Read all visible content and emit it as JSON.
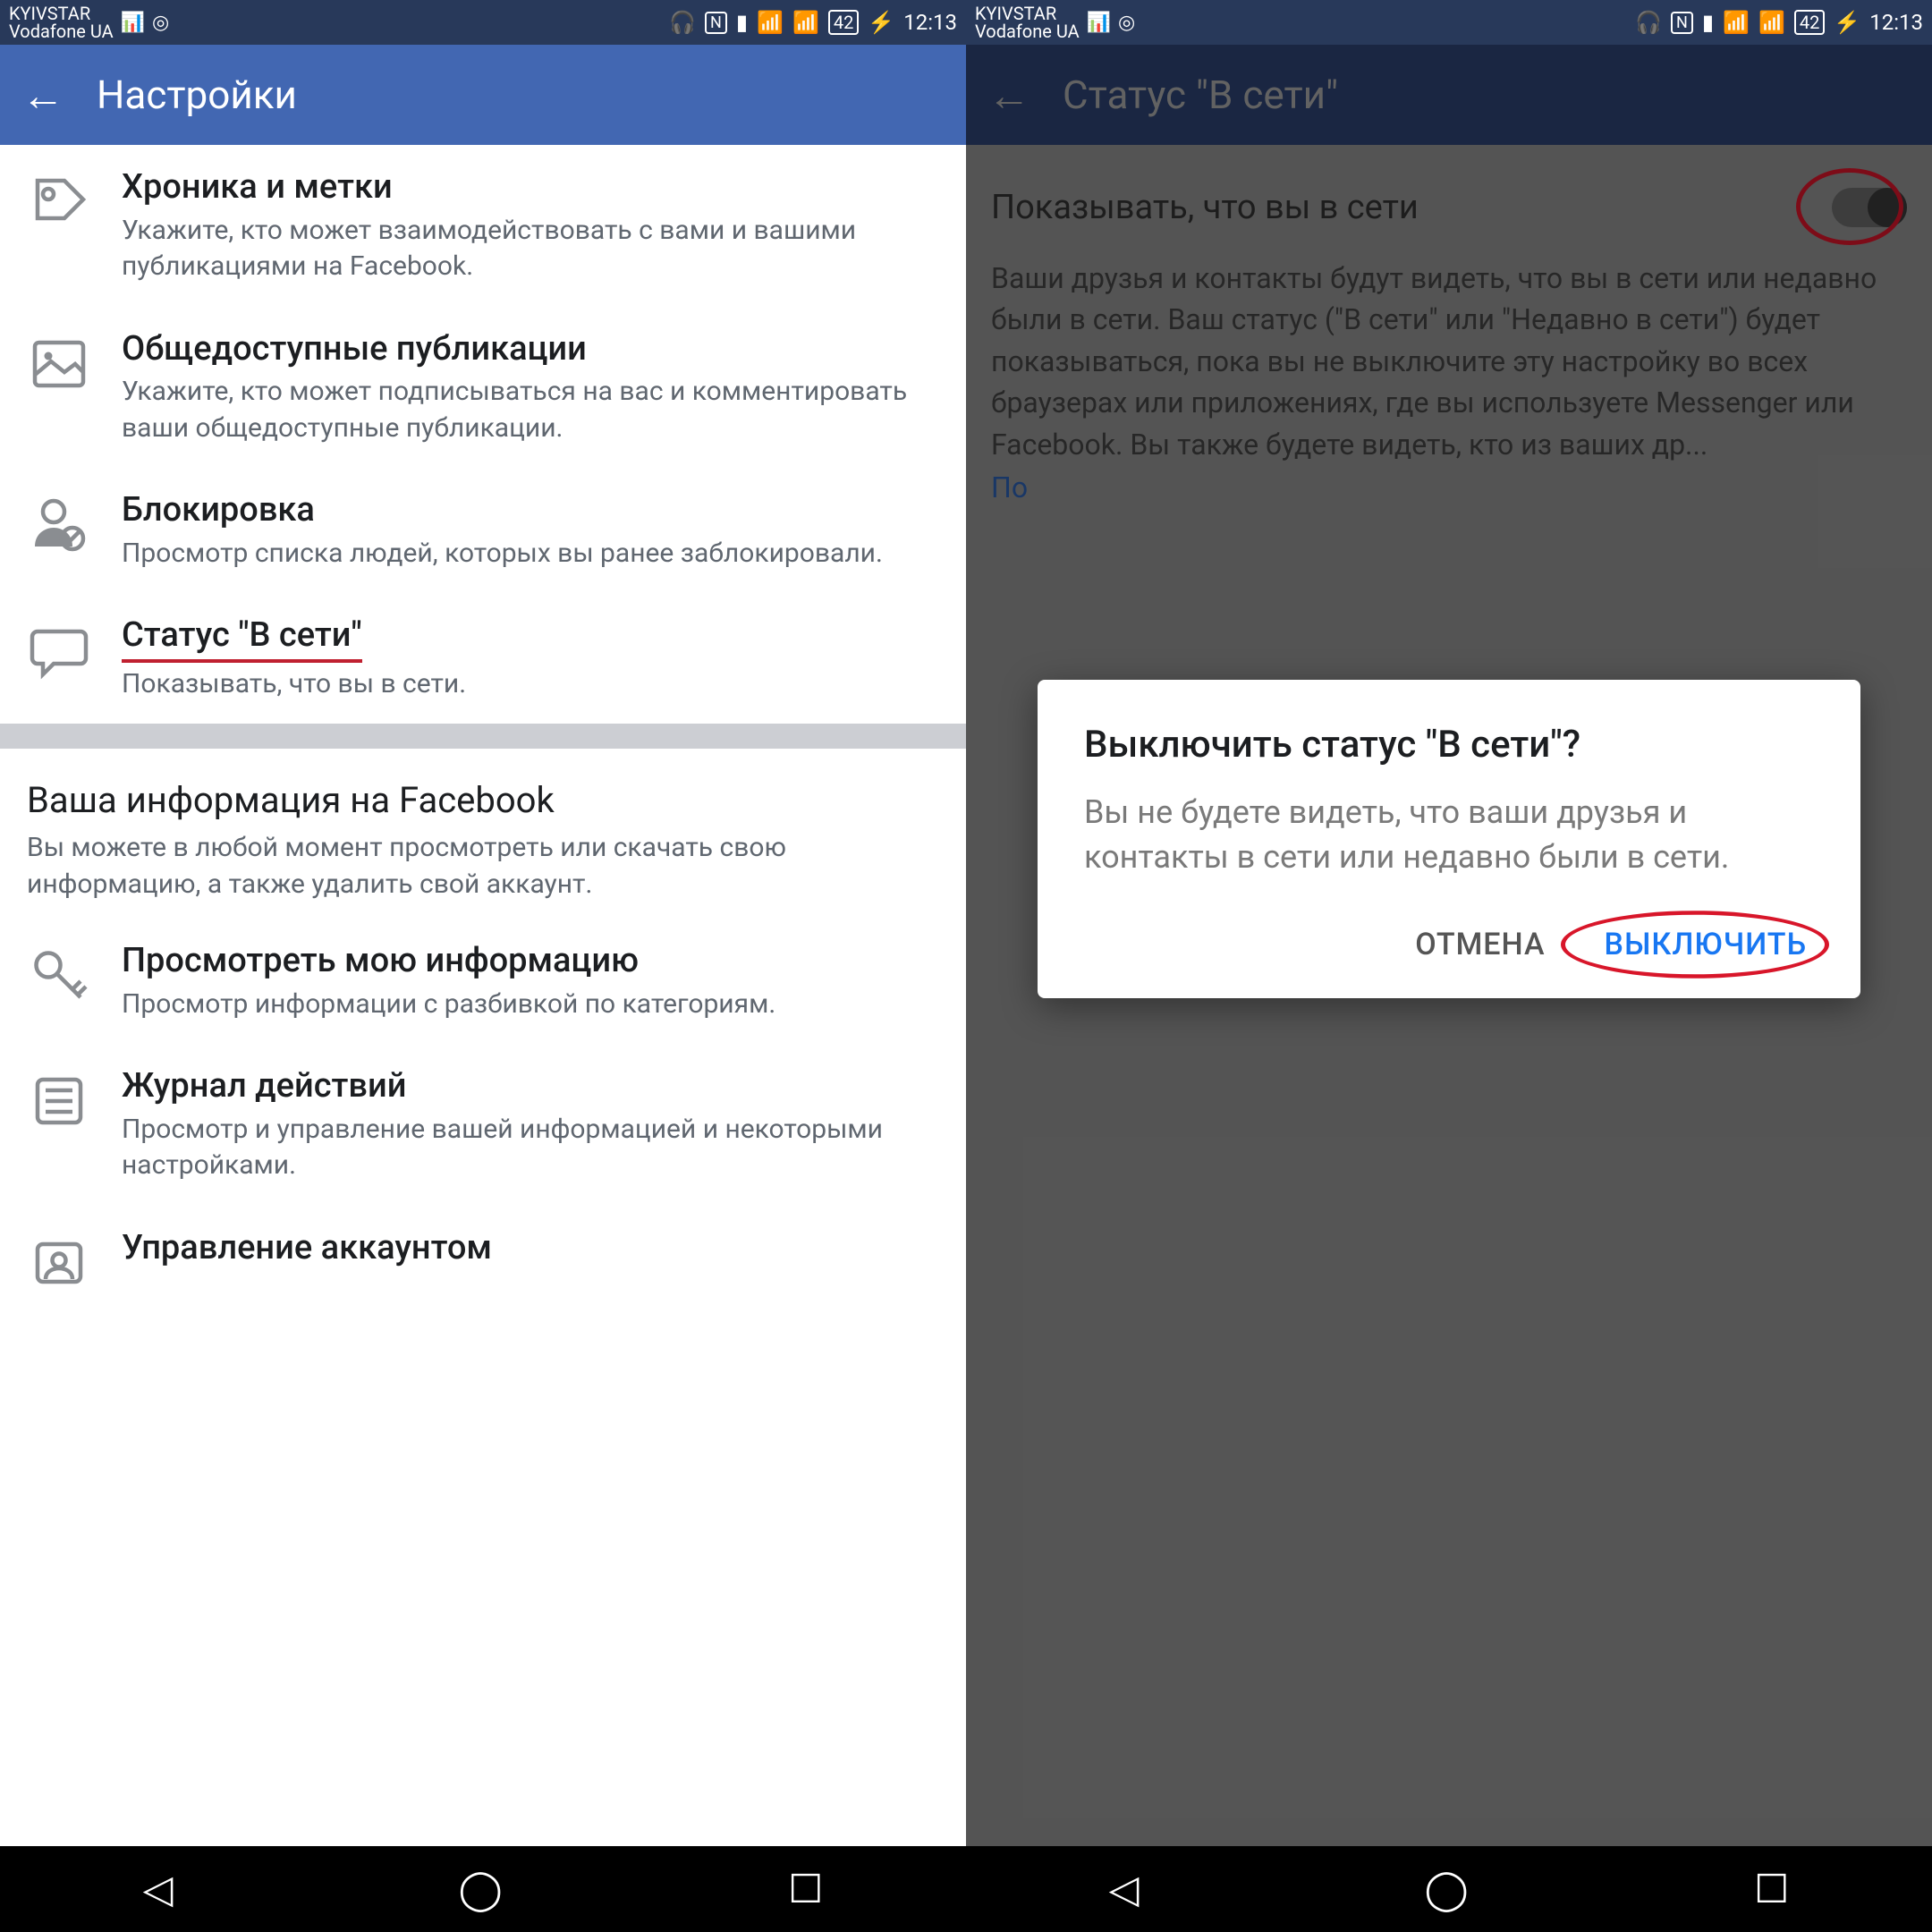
{
  "status": {
    "carrier1": "KYIVSTAR",
    "carrier2": "Vodafone UA",
    "battery": "42",
    "time": "12:13"
  },
  "left": {
    "header_title": "Настройки",
    "items": [
      {
        "title": "Хроника и метки",
        "sub": "Укажите, кто может взаимодействовать с вами и вашими публикациями на Facebook."
      },
      {
        "title": "Общедоступные публикации",
        "sub": "Укажите, кто может подписываться на вас и комментировать ваши общедоступные публикации."
      },
      {
        "title": "Блокировка",
        "sub": "Просмотр списка людей, которых вы ранее заблокировали."
      },
      {
        "title": "Статус \"В сети\"",
        "sub": "Показывать, что вы в сети."
      }
    ],
    "section": {
      "title": "Ваша информация на Facebook",
      "sub": "Вы можете в любой момент просмотреть или скачать свою информацию, а также удалить свой аккаунт."
    },
    "items2": [
      {
        "title": "Просмотреть мою информацию",
        "sub": "Просмотр информации с разбивкой по категориям."
      },
      {
        "title": "Журнал действий",
        "sub": "Просмотр и управление вашей информацией и некоторыми настройками."
      },
      {
        "title": "Управление аккаунтом",
        "sub": ""
      }
    ]
  },
  "right": {
    "header_title": "Статус \"В сети\"",
    "toggle_label": "Показывать, что вы в сети",
    "description": "Ваши друзья и контакты будут видеть, что вы в сети или недавно были в сети. Ваш статус (\"В сети\" или \"Недавно в сети\") будет показываться, пока вы не выключите эту настройку во всех браузерах или приложениях, где вы используете Messenger или Facebook. Вы также будете видеть, кто из ваших др...",
    "link_partial": "По",
    "dialog": {
      "title": "Выключить статус \"В сети\"?",
      "body": "Вы не будете видеть, что ваши друзья и контакты в сети или недавно были в сети.",
      "cancel": "ОТМЕНА",
      "confirm": "ВЫКЛЮЧИТЬ"
    }
  }
}
